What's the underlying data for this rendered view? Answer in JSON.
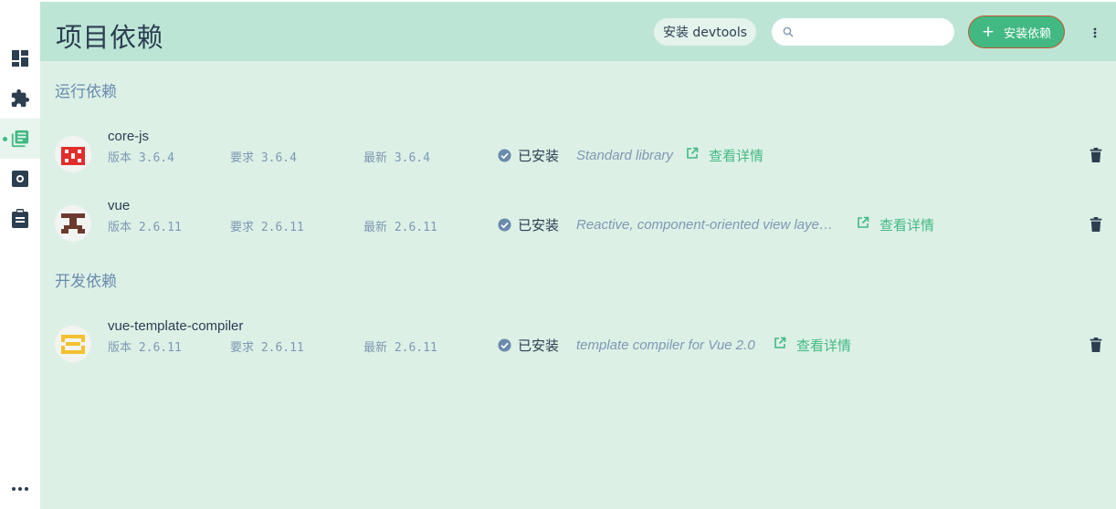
{
  "header": {
    "title": "项目依赖",
    "devtools_label": "安装 devtools",
    "search_placeholder": "",
    "install_label": "安装依赖"
  },
  "sidebar": {
    "items": [
      {
        "name": "dashboard",
        "icon": "dashboard-icon"
      },
      {
        "name": "plugins",
        "icon": "puzzle-icon"
      },
      {
        "name": "dependencies",
        "icon": "library-icon",
        "active": true
      },
      {
        "name": "configuration",
        "icon": "settings-icon"
      },
      {
        "name": "tasks",
        "icon": "clipboard-icon"
      },
      {
        "name": "more",
        "icon": "more-horizontal-icon"
      }
    ]
  },
  "sections": {
    "runtime": "运行依赖",
    "dev": "开发依赖"
  },
  "dependencies": [
    {
      "name": "core-js",
      "version": "版本 3.6.4",
      "wanted": "要求 3.6.4",
      "latest": "最新 3.6.4",
      "status": "已安装",
      "description": "Standard library",
      "link": "查看详情"
    },
    {
      "name": "vue",
      "version": "版本 2.6.11",
      "wanted": "要求 2.6.11",
      "latest": "最新 2.6.11",
      "status": "已安装",
      "description": "Reactive, component-oriented view laye…",
      "link": "查看详情"
    },
    {
      "name": "vue-template-compiler",
      "version": "版本 2.6.11",
      "wanted": "要求 2.6.11",
      "latest": "最新 2.6.11",
      "status": "已安装",
      "description": "template compiler for Vue 2.0",
      "link": "查看详情"
    }
  ],
  "colors": {
    "accent": "#42b983",
    "header_bg": "#bde5d6",
    "content_bg": "#dcf0e6",
    "muted_text": "#7f98b3",
    "status_icon": "#6a8bad"
  }
}
